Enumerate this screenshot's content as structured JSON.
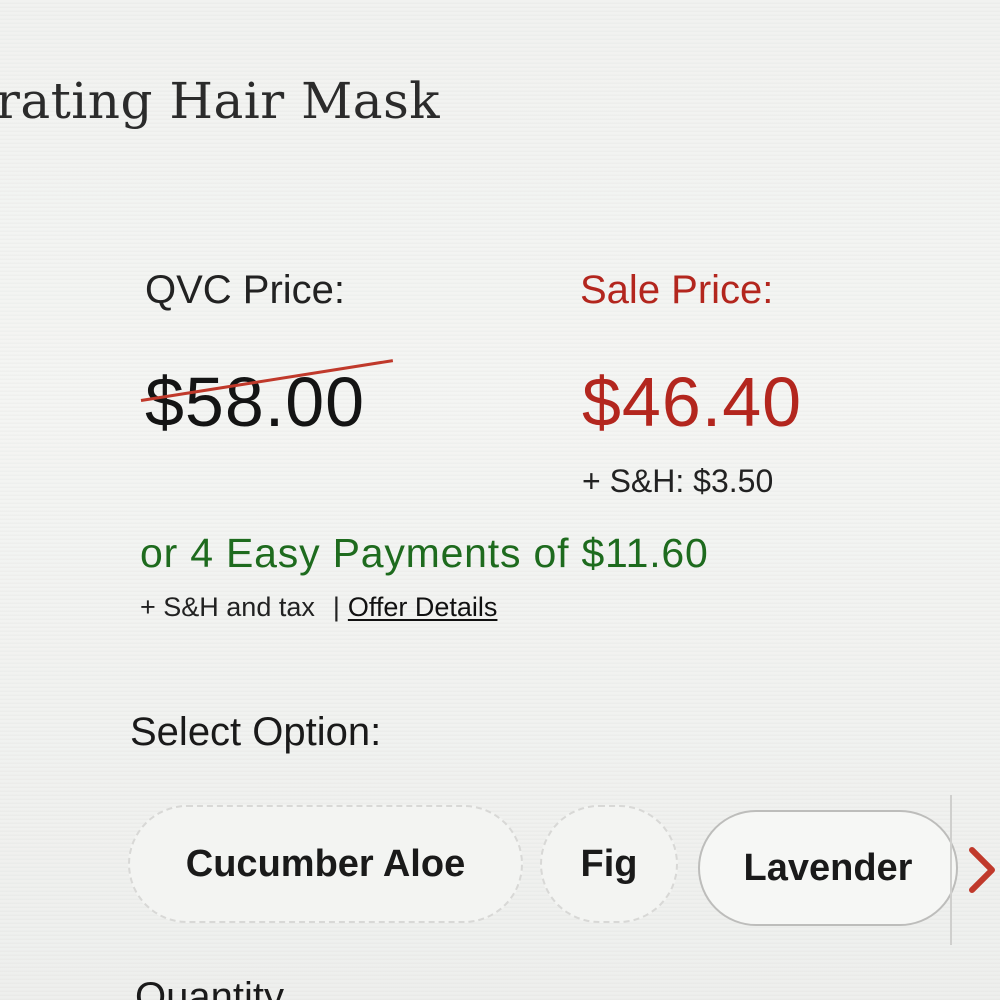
{
  "product": {
    "title": "rating Hair Mask"
  },
  "pricing": {
    "qvc_label": "QVC Price:",
    "qvc_price": "$58.00",
    "sale_label": "Sale Price:",
    "sale_price": "$46.40",
    "shipping": "+ S&H: $3.50",
    "easy_pay": "or 4 Easy Payments of $11.60",
    "tax_note": "+ S&H and tax",
    "separator": "|",
    "offer_details": "Offer Details"
  },
  "options": {
    "label": "Select Option:",
    "items": [
      {
        "label": "Cucumber Aloe"
      },
      {
        "label": "Fig"
      },
      {
        "label": "Lavender"
      }
    ],
    "next_icon": "chevron-right-icon"
  },
  "quantity": {
    "label": "Quantity"
  },
  "colors": {
    "sale_red": "#b3261e",
    "strike_red": "#c0392b",
    "easy_pay_green": "#1e6b1e"
  }
}
